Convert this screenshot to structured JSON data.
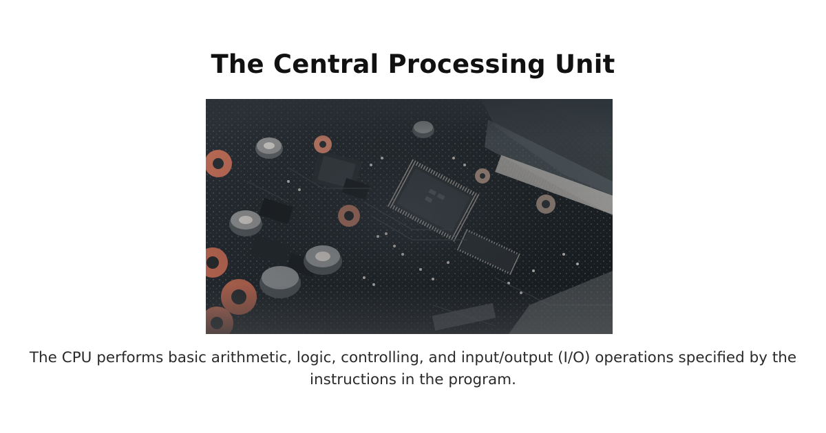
{
  "heading": {
    "title": "The Central Processing Unit"
  },
  "figure": {
    "image_subject": "circuit-board-photo"
  },
  "body": {
    "caption": "The CPU performs basic arithmetic, logic, controlling, and input/output (I/O) operations specified by the instructions in the program."
  },
  "colors": {
    "board_dark": "#1c2227",
    "chip": "#2b3034",
    "copper": "#b96a55",
    "highlight": "#c9c2bb"
  }
}
